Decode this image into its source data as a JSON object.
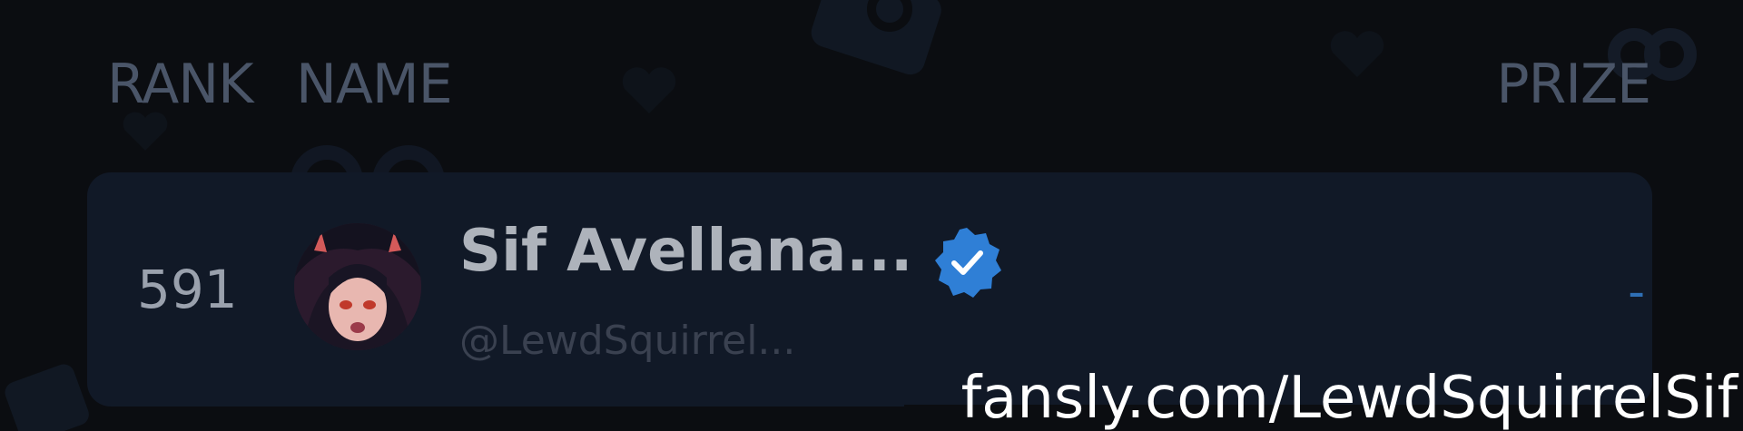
{
  "leaderboard": {
    "columns": {
      "rank": "RANK",
      "name": "NAME",
      "prize": "PRIZE"
    },
    "rows": [
      {
        "rank": "591",
        "display_name": "Sif Avellana...",
        "handle": "@LewdSquirrel...",
        "prize": "-",
        "verified": true
      }
    ]
  },
  "watermark": "fansly.com/LewdSquirrelSif",
  "colors": {
    "background": "#0b0d11",
    "row_background": "#111927",
    "header_text": "#4a5568",
    "verified_badge": "#2f7fd6",
    "prize_text": "#2f6fb5"
  }
}
